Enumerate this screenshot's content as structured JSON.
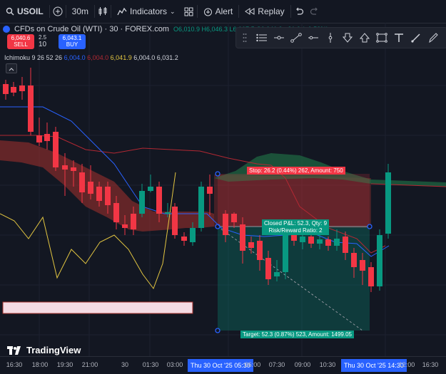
{
  "toolbar": {
    "symbol": "USOIL",
    "interval": "30m",
    "indicators_label": "Indicators",
    "alert_label": "Alert",
    "replay_label": "Replay"
  },
  "legend": {
    "title": "CFDs on Crude Oil (WTI) · 30 · FOREX.com",
    "ohlc_text": "O6,010.9  H6,046.3  L6,007.5  C6,041.9  +31.0 (+0.52%)",
    "sell_price": "6,040.6",
    "sell_label": "SELL",
    "buy_price": "6,043.1",
    "buy_label": "BUY",
    "spread_value": "2.5",
    "quantity": "10",
    "ichimoku_label": "Ichimoku 9 26 52 26",
    "ichimoku_values": [
      "6,004.0",
      "6,004.0",
      "6,041.9",
      "6,004.0",
      "6,031.2"
    ]
  },
  "position": {
    "stop_label": "Stop: 26.2 (0.44%) 262, Amount: 750",
    "closed_pl_line1": "Closed P&L: 52.3, Qty: 9",
    "closed_pl_line2": "Risk/Reward Ratio: 2",
    "target_label": "Target: 52.3 (0.87%) 523, Amount: 1499.05"
  },
  "time_axis": {
    "ticks": [
      "16:30",
      "18:00",
      "19:30",
      "21:00",
      "30",
      "01:30",
      "03:00",
      "06:00",
      "07:30",
      "09:00",
      "10:30",
      "12:00",
      "16:30",
      "18:00"
    ],
    "badge_left": "Thu 30 Oct '25  05:30",
    "badge_right": "Thu 30 Oct '25  14:30"
  },
  "branding": {
    "logo_text": "TradingView"
  },
  "colors": {
    "background": "#131722",
    "up": "#089981",
    "down": "#f23645",
    "accent": "#2962ff",
    "cloud_red": "#a5312d",
    "cloud_green": "#1f6b43"
  }
}
